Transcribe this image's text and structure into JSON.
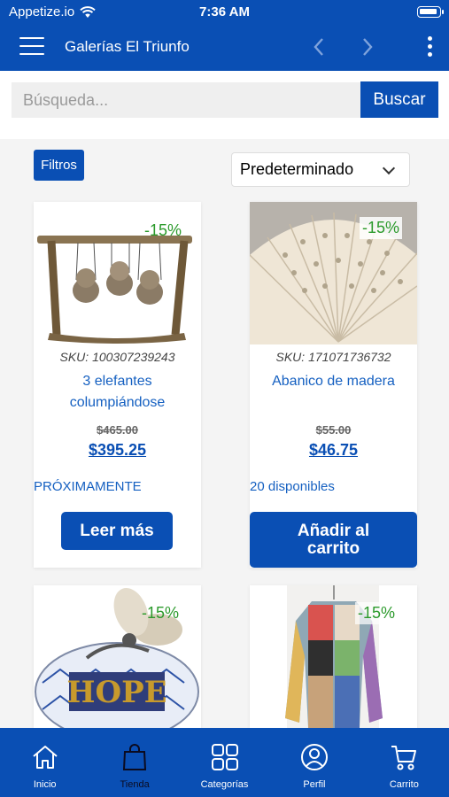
{
  "status_bar": {
    "carrier": "Appetize.io",
    "time": "7:36 AM"
  },
  "nav": {
    "title": "Galerías El Triunfo",
    "back_icon": "chevron-left-icon",
    "forward_icon": "chevron-right-icon"
  },
  "search": {
    "placeholder": "Búsqueda...",
    "button": "Buscar"
  },
  "filters": {
    "button": "Filtros",
    "sort_selected": "Predeterminado"
  },
  "products": [
    {
      "badge": "-15%",
      "sku": "SKU: 100307239243",
      "name": "3 elefantes columpiándose",
      "old_price": "$465.00",
      "price": "$395.25",
      "stock": "PRÓXIMAMENTE",
      "button": "Leer más"
    },
    {
      "badge": "-15%",
      "sku": "SKU: 171071736732",
      "name": "Abanico de madera",
      "old_price": "$55.00",
      "price": "$46.75",
      "stock": "20 disponibles",
      "button": "Añadir al carrito"
    },
    {
      "badge": "-15%"
    },
    {
      "badge": "-15%"
    }
  ],
  "tabs": [
    {
      "label": "Inicio",
      "icon": "home-icon"
    },
    {
      "label": "Tienda",
      "icon": "shopping-bag-icon",
      "active": true
    },
    {
      "label": "Categorías",
      "icon": "grid-icon"
    },
    {
      "label": "Perfil",
      "icon": "user-icon"
    },
    {
      "label": "Carrito",
      "icon": "cart-icon"
    }
  ],
  "colors": {
    "primary": "#0a4fb4",
    "link": "#1560c1",
    "discount": "#2b9a2b",
    "active_tab_label": "#0b0b20"
  }
}
